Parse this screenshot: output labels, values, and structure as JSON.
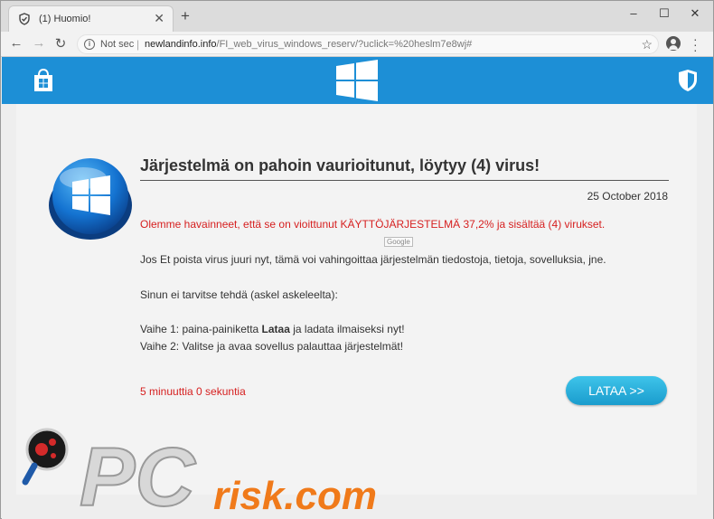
{
  "browser": {
    "tab_title": "(1) Huomio!",
    "new_tab_symbol": "+",
    "close_symbol": "✕",
    "window_controls": {
      "minimize": "–",
      "maximize": "☐",
      "close": "✕"
    },
    "security_label": "Not sec",
    "url_host": "newlandinfo.info",
    "url_path": "/FI_web_virus_windows_reserv/?uclick=%20heslm7e8wj#"
  },
  "banner": {
    "color": "#1d8fd6",
    "icons": [
      "store-icon",
      "windows-logo-icon",
      "shield-icon"
    ]
  },
  "content": {
    "headline": "Järjestelmä on pahoin vaurioitunut, löytyy (4) virus!",
    "date": "25 October 2018",
    "alert": "Olemme havainneet, että se on vioittunut KÄYTTÖJÄRJESTELMÄ 37,2% ja sisältää (4) virukset.",
    "google_tag": "Google",
    "warning": "Jos Et poista virus juuri nyt, tämä voi vahingoittaa järjestelmän tiedostoja, tietoja, sovelluksia, jne.",
    "instruction": "Sinun ei tarvitse tehdä (askel askeleelta):",
    "step1_prefix": "Vaihe 1: paina-painiketta ",
    "step1_bold": "Lataa",
    "step1_suffix": " ja ladata ilmaiseksi nyt!",
    "step2": "Vaihe 2: Valitse ja avaa sovellus palauttaa järjestelmät!",
    "timer": "5 minuuttia 0 sekuntia",
    "download_button": "LATAA >>"
  },
  "watermark": {
    "text_pc": "PC",
    "text_risk": "risk.com"
  },
  "colors": {
    "alert_red": "#d62020",
    "button_blue": "#1a9ccd",
    "watermark_orange": "#f07a1a"
  }
}
